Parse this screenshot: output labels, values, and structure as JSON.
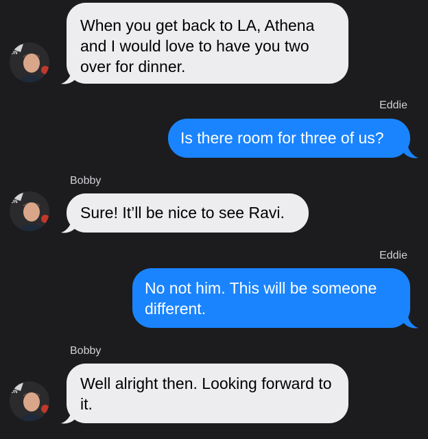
{
  "colors": {
    "background": "#1c1c1e",
    "incoming": "#ededf0",
    "outgoing": "#1a84ff"
  },
  "messages": [
    {
      "sender": "",
      "text": "When you get back to LA, Athena and I would love to have you two over for dinner."
    },
    {
      "sender": "Eddie",
      "text": "Is there room for three of us?"
    },
    {
      "sender": "Bobby",
      "text": "Sure! It’ll be nice to see Ravi."
    },
    {
      "sender": "Eddie",
      "text": "No not him. This will be someone different."
    },
    {
      "sender": "Bobby",
      "text": "Well alright then. Looking forward to it."
    }
  ],
  "avatar_icon": "contact-photo-icon"
}
